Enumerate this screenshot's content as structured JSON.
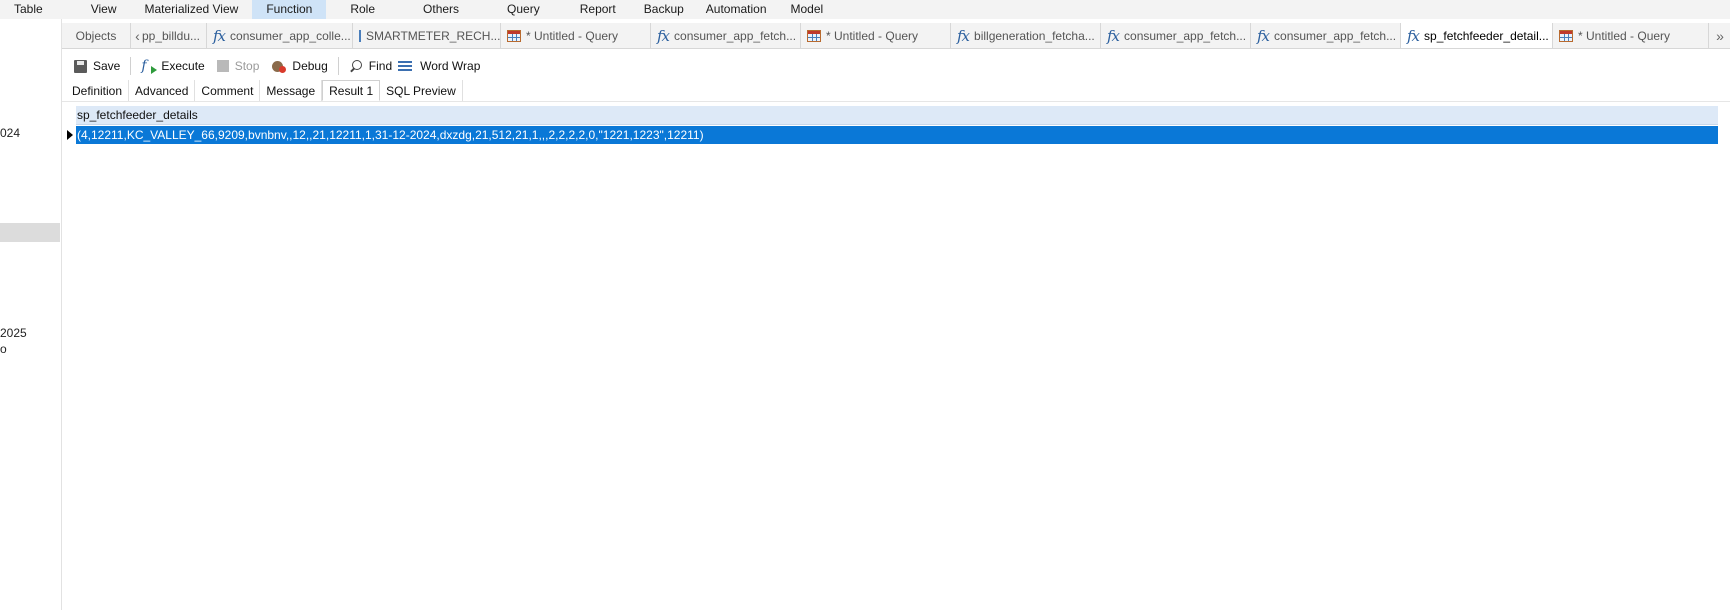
{
  "menubar": {
    "items": [
      "Table",
      "View",
      "Materialized View",
      "Function",
      "Role",
      "Others",
      "Query",
      "Report",
      "Backup",
      "Automation",
      "Model"
    ],
    "active_index": 3
  },
  "sidebar": {
    "fragments": [
      "024",
      "2025",
      "o"
    ]
  },
  "tabs": {
    "objects": "Objects",
    "items": [
      {
        "label": "pp_billdu...",
        "icon": "none"
      },
      {
        "label": "consumer_app_colle...",
        "icon": "function-icon"
      },
      {
        "label": "SMARTMETER_RECH...",
        "icon": "table-icon"
      },
      {
        "label": "* Untitled - Query",
        "icon": "query-icon"
      },
      {
        "label": "consumer_app_fetch...",
        "icon": "function-icon"
      },
      {
        "label": "* Untitled - Query",
        "icon": "query-icon"
      },
      {
        "label": "billgeneration_fetcha...",
        "icon": "function-icon"
      },
      {
        "label": "consumer_app_fetch...",
        "icon": "function-icon"
      },
      {
        "label": "consumer_app_fetch...",
        "icon": "function-icon"
      },
      {
        "label": "sp_fetchfeeder_detail...",
        "icon": "function-icon",
        "active": true
      },
      {
        "label": "* Untitled - Query",
        "icon": "query-icon"
      }
    ]
  },
  "toolbar": {
    "save": "Save",
    "execute": "Execute",
    "stop": "Stop",
    "debug": "Debug",
    "find": "Find",
    "word_wrap": "Word Wrap"
  },
  "subtabs": {
    "items": [
      "Definition",
      "Advanced",
      "Comment",
      "Message",
      "Result 1",
      "SQL Preview"
    ],
    "active_index": 4
  },
  "result": {
    "column": "sp_fetchfeeder_details",
    "rows": [
      "(4,12211,KC_VALLEY_66,9209,bvnbnv,,12,,21,12211,1,31-12-2024,dxzdg,21,512,21,1,,,2,2,2,2,0,\"1221,1223\",12211)"
    ]
  },
  "colors": {
    "accent": "#0a78d7",
    "menu_active": "#cfe3f7",
    "header_bg": "#dde9f7"
  }
}
